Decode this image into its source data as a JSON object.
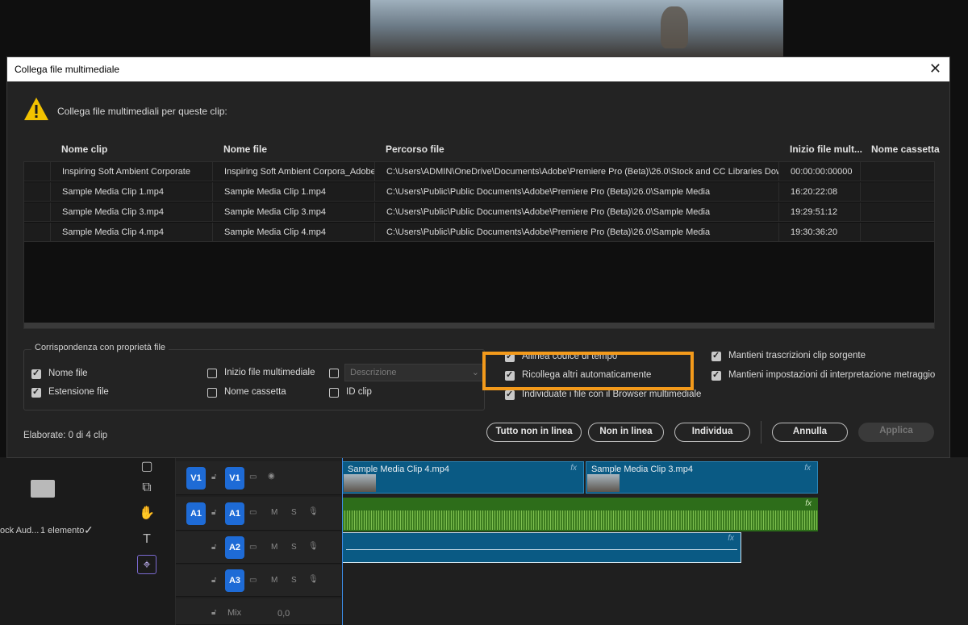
{
  "dialog": {
    "title": "Collega file multimediale",
    "prompt": "Collega file multimediali per queste clip:",
    "columns": [
      "Nome clip",
      "Nome file",
      "Percorso file",
      "Inizio file mult...",
      "Nome cassetta"
    ],
    "rows": [
      {
        "clip": "Inspiring Soft Ambient Corporate",
        "file": "Inspiring Soft Ambient Corpora_Adobe",
        "path": "C:\\Users\\ADMIN\\OneDrive\\Documents\\Adobe\\Premiere Pro (Beta)\\26.0\\Stock and CC Libraries Dow",
        "start": "00:00:00:00000",
        "tape": ""
      },
      {
        "clip": "Sample Media Clip 1.mp4",
        "file": "Sample Media Clip 1.mp4",
        "path": "C:\\Users\\Public\\Public Documents\\Adobe\\Premiere Pro (Beta)\\26.0\\Sample Media",
        "start": "16:20:22:08",
        "tape": ""
      },
      {
        "clip": "Sample Media Clip 3.mp4",
        "file": "Sample Media Clip 3.mp4",
        "path": "C:\\Users\\Public\\Public Documents\\Adobe\\Premiere Pro (Beta)\\26.0\\Sample Media",
        "start": "19:29:51:12",
        "tape": ""
      },
      {
        "clip": "Sample Media Clip 4.mp4",
        "file": "Sample Media Clip 4.mp4",
        "path": "C:\\Users\\Public\\Public Documents\\Adobe\\Premiere Pro (Beta)\\26.0\\Sample Media",
        "start": "19:30:36:20",
        "tape": ""
      }
    ],
    "match_group": {
      "title": "Corrispondenza con proprietà file",
      "nome_file": "Nome file",
      "estensione_file": "Estensione file",
      "inizio_file": "Inizio file multimediale",
      "nome_cassetta": "Nome cassetta",
      "id_clip": "ID clip",
      "descrizione": "Descrizione"
    },
    "options": {
      "allinea": "Allinea codice di tempo",
      "ricollega": "Ricollega altri automaticamente",
      "individuate": "Individuate i file con il Browser multimediale",
      "mantieni_trascrizioni": "Mantieni trascrizioni clip sorgente",
      "mantieni_impostazioni": "Mantieni impostazioni di interpretazione metraggio"
    },
    "status": "Elaborate: 0 di 4 clip",
    "buttons": {
      "tutto_non_in_linea": "Tutto non in linea",
      "non_in_linea": "Non in linea",
      "individua": "Individua",
      "annulla": "Annulla",
      "applica": "Applica"
    },
    "highlight_color": "#f39a1b"
  },
  "timeline": {
    "clip_v1_a": "Sample Media Clip 4.mp4",
    "clip_v1_b": "Sample Media Clip 3.mp4",
    "tracks": {
      "v1": "V1",
      "a1": "A1",
      "a2": "A2",
      "a3": "A3",
      "mix": "Mix",
      "mix_value": "0,0"
    },
    "fx": "fx",
    "track_m": "M",
    "track_s": "S"
  },
  "project": {
    "item_name": "ock Aud...",
    "item_count": "1 elemento"
  }
}
